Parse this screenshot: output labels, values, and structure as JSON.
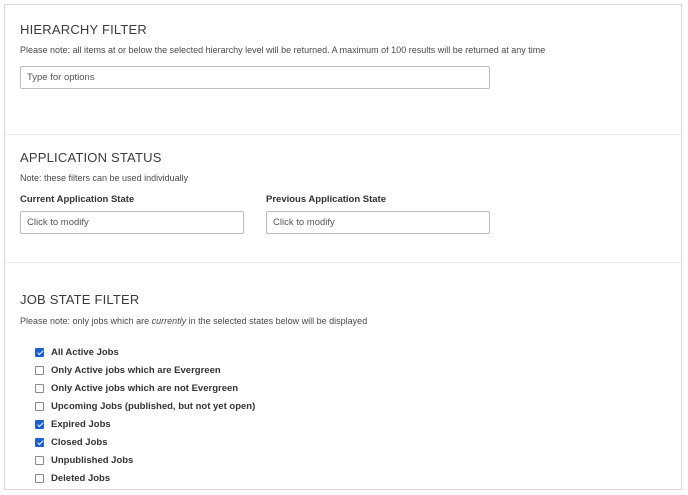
{
  "hierarchy": {
    "title": "HIERARCHY FILTER",
    "note": "Please note: all items at or below the selected hierarchy level will be returned. A maximum of 100 results will be returned at any time",
    "input_placeholder": "Type for options"
  },
  "application_status": {
    "title": "APPLICATION STATUS",
    "note": "Note: these filters can be used individually",
    "current_label": "Current Application State",
    "current_placeholder": "Click to modify",
    "previous_label": "Previous Application State",
    "previous_placeholder": "Click to modify"
  },
  "job_state": {
    "title": "JOB STATE FILTER",
    "note_prefix": "Please note: only jobs which are ",
    "note_emphasis": "currently",
    "note_suffix": " in the selected states below will be displayed",
    "options": [
      {
        "label": "All Active Jobs",
        "checked": true
      },
      {
        "label": "Only Active jobs which are Evergreen",
        "checked": false
      },
      {
        "label": "Only Active jobs which are not Evergreen",
        "checked": false
      },
      {
        "label": "Upcoming Jobs (published, but not yet open)",
        "checked": false
      },
      {
        "label": "Expired Jobs",
        "checked": true
      },
      {
        "label": "Closed Jobs",
        "checked": true
      },
      {
        "label": "Unpublished Jobs",
        "checked": false
      },
      {
        "label": "Deleted Jobs",
        "checked": false
      }
    ]
  },
  "colors": {
    "checkbox_checked": "#1f5fd6",
    "border": "#d9d9d9"
  }
}
